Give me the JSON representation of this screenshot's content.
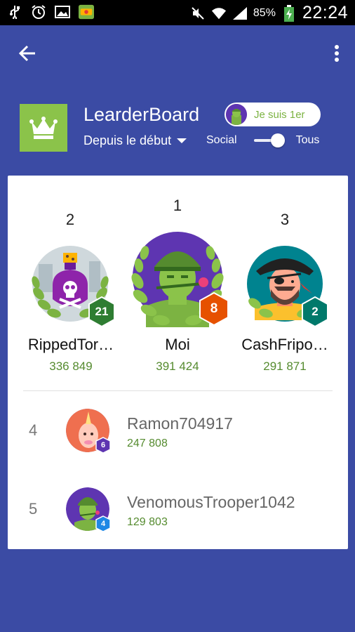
{
  "status_bar": {
    "battery": "85%",
    "time": "22:24",
    "icons": [
      "usb-icon",
      "alarm-icon",
      "image-icon",
      "app-icon",
      "mute-icon",
      "wifi-icon",
      "signal-icon",
      "battery-icon"
    ]
  },
  "appbar": {
    "back_icon": "arrow-back-icon",
    "menu_icon": "more-vert-icon"
  },
  "header": {
    "title": "LearderBoard",
    "period": "Depuis le début",
    "first_pill": "Je suis 1er",
    "toggle_left": "Social",
    "toggle_right": "Tous"
  },
  "podium": [
    {
      "rank": "2",
      "name": "RippedTor…",
      "score": "336 849",
      "level": "21",
      "level_color": "#2e7d32"
    },
    {
      "rank": "1",
      "name": "Moi",
      "score": "391 424",
      "level": "8",
      "level_color": "#e65100"
    },
    {
      "rank": "3",
      "name": "CashFripo…",
      "score": "291 871",
      "level": "2",
      "level_color": "#00796b"
    }
  ],
  "list": [
    {
      "rank": "4",
      "name": "Ramon704917",
      "score": "247 808",
      "level": "6",
      "level_color": "#5e35b1"
    },
    {
      "rank": "5",
      "name": "VenomousTrooper1042",
      "score": "129 803",
      "level": "4",
      "level_color": "#1e88e5"
    }
  ],
  "colors": {
    "primary": "#3b4ba4",
    "accent_green": "#8bc34a",
    "score_green": "#558b2f"
  }
}
